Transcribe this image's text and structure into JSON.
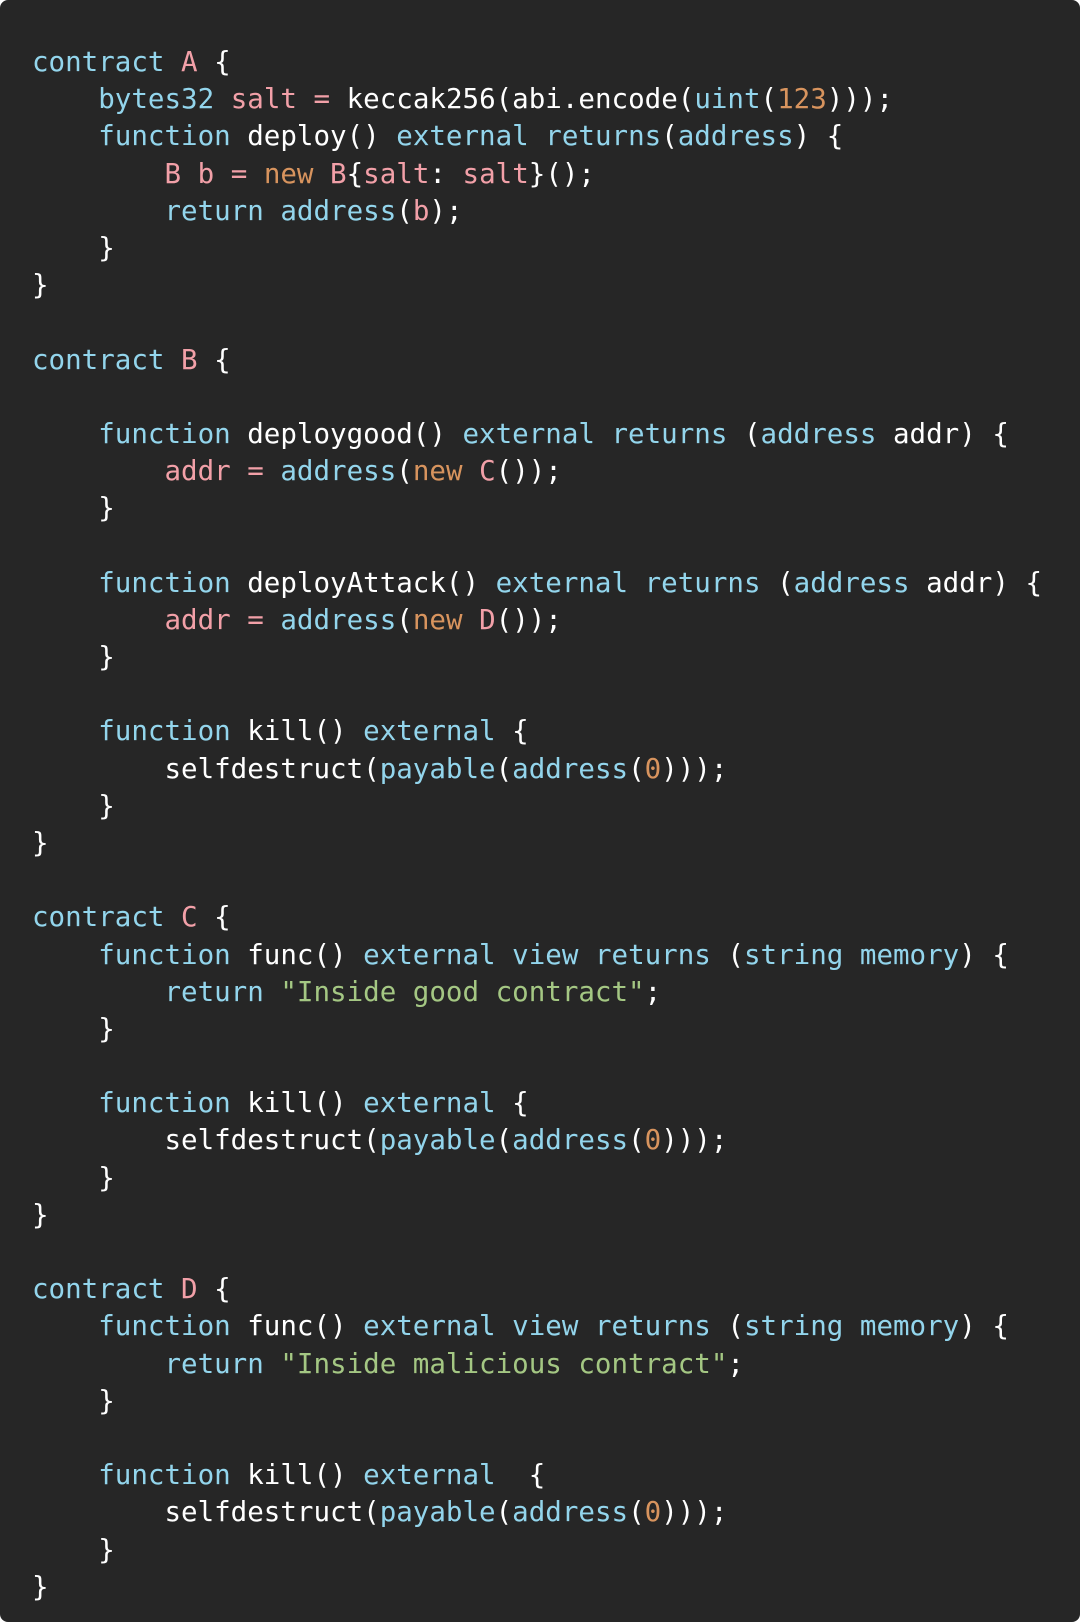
{
  "theme": {
    "background": "#262626",
    "default": "#ffffff",
    "keyword": "#93d5ec",
    "name": "#f2a0a8",
    "number": "#d8945e",
    "string": "#a4c783"
  },
  "code": {
    "language": "solidity",
    "lines": [
      [
        [
          "keyword",
          "contract"
        ],
        [
          "default",
          " "
        ],
        [
          "name",
          "A"
        ],
        [
          "default",
          " {"
        ]
      ],
      [
        [
          "default",
          "    "
        ],
        [
          "keyword",
          "bytes32"
        ],
        [
          "default",
          " "
        ],
        [
          "name",
          "salt"
        ],
        [
          "default",
          " "
        ],
        [
          "name",
          "="
        ],
        [
          "default",
          " keccak256(abi.encode("
        ],
        [
          "keyword",
          "uint"
        ],
        [
          "default",
          "("
        ],
        [
          "number",
          "123"
        ],
        [
          "default",
          ")));"
        ]
      ],
      [
        [
          "default",
          "    "
        ],
        [
          "keyword",
          "function"
        ],
        [
          "default",
          " deploy() "
        ],
        [
          "keyword",
          "external"
        ],
        [
          "default",
          " "
        ],
        [
          "keyword",
          "returns"
        ],
        [
          "default",
          "("
        ],
        [
          "keyword",
          "address"
        ],
        [
          "default",
          ") {"
        ]
      ],
      [
        [
          "default",
          "        "
        ],
        [
          "name",
          "B b"
        ],
        [
          "default",
          " "
        ],
        [
          "name",
          "="
        ],
        [
          "default",
          " "
        ],
        [
          "number",
          "new"
        ],
        [
          "default",
          " "
        ],
        [
          "name",
          "B"
        ],
        [
          "default",
          "{"
        ],
        [
          "name",
          "salt"
        ],
        [
          "default",
          ": "
        ],
        [
          "name",
          "salt"
        ],
        [
          "default",
          "}();"
        ]
      ],
      [
        [
          "default",
          "        "
        ],
        [
          "keyword",
          "return"
        ],
        [
          "default",
          " "
        ],
        [
          "keyword",
          "address"
        ],
        [
          "default",
          "("
        ],
        [
          "name",
          "b"
        ],
        [
          "default",
          ");"
        ]
      ],
      [
        [
          "default",
          "    }"
        ]
      ],
      [
        [
          "default",
          "}"
        ]
      ],
      [],
      [
        [
          "keyword",
          "contract"
        ],
        [
          "default",
          " "
        ],
        [
          "name",
          "B"
        ],
        [
          "default",
          " {"
        ]
      ],
      [],
      [
        [
          "default",
          "    "
        ],
        [
          "keyword",
          "function"
        ],
        [
          "default",
          " deploygood() "
        ],
        [
          "keyword",
          "external"
        ],
        [
          "default",
          " "
        ],
        [
          "keyword",
          "returns"
        ],
        [
          "default",
          " ("
        ],
        [
          "keyword",
          "address"
        ],
        [
          "default",
          " addr) {"
        ]
      ],
      [
        [
          "default",
          "        "
        ],
        [
          "name",
          "addr"
        ],
        [
          "default",
          " "
        ],
        [
          "name",
          "="
        ],
        [
          "default",
          " "
        ],
        [
          "keyword",
          "address"
        ],
        [
          "default",
          "("
        ],
        [
          "number",
          "new"
        ],
        [
          "default",
          " "
        ],
        [
          "name",
          "C"
        ],
        [
          "default",
          "());"
        ]
      ],
      [
        [
          "default",
          "    }"
        ]
      ],
      [],
      [
        [
          "default",
          "    "
        ],
        [
          "keyword",
          "function"
        ],
        [
          "default",
          " deployAttack() "
        ],
        [
          "keyword",
          "external"
        ],
        [
          "default",
          " "
        ],
        [
          "keyword",
          "returns"
        ],
        [
          "default",
          " ("
        ],
        [
          "keyword",
          "address"
        ],
        [
          "default",
          " addr) {"
        ]
      ],
      [
        [
          "default",
          "        "
        ],
        [
          "name",
          "addr"
        ],
        [
          "default",
          " "
        ],
        [
          "name",
          "="
        ],
        [
          "default",
          " "
        ],
        [
          "keyword",
          "address"
        ],
        [
          "default",
          "("
        ],
        [
          "number",
          "new"
        ],
        [
          "default",
          " "
        ],
        [
          "name",
          "D"
        ],
        [
          "default",
          "());"
        ]
      ],
      [
        [
          "default",
          "    }"
        ]
      ],
      [],
      [
        [
          "default",
          "    "
        ],
        [
          "keyword",
          "function"
        ],
        [
          "default",
          " kill() "
        ],
        [
          "keyword",
          "external"
        ],
        [
          "default",
          " {"
        ]
      ],
      [
        [
          "default",
          "        selfdestruct("
        ],
        [
          "keyword",
          "payable"
        ],
        [
          "default",
          "("
        ],
        [
          "keyword",
          "address"
        ],
        [
          "default",
          "("
        ],
        [
          "number",
          "0"
        ],
        [
          "default",
          ")));"
        ]
      ],
      [
        [
          "default",
          "    }"
        ]
      ],
      [
        [
          "default",
          "}"
        ]
      ],
      [],
      [
        [
          "keyword",
          "contract"
        ],
        [
          "default",
          " "
        ],
        [
          "name",
          "C"
        ],
        [
          "default",
          " {"
        ]
      ],
      [
        [
          "default",
          "    "
        ],
        [
          "keyword",
          "function"
        ],
        [
          "default",
          " func() "
        ],
        [
          "keyword",
          "external"
        ],
        [
          "default",
          " "
        ],
        [
          "keyword",
          "view"
        ],
        [
          "default",
          " "
        ],
        [
          "keyword",
          "returns"
        ],
        [
          "default",
          " ("
        ],
        [
          "keyword",
          "string"
        ],
        [
          "default",
          " "
        ],
        [
          "keyword",
          "memory"
        ],
        [
          "default",
          ") {"
        ]
      ],
      [
        [
          "default",
          "        "
        ],
        [
          "keyword",
          "return"
        ],
        [
          "default",
          " "
        ],
        [
          "string",
          "\"Inside good contract\""
        ],
        [
          "default",
          ";"
        ]
      ],
      [
        [
          "default",
          "    }"
        ]
      ],
      [],
      [
        [
          "default",
          "    "
        ],
        [
          "keyword",
          "function"
        ],
        [
          "default",
          " kill() "
        ],
        [
          "keyword",
          "external"
        ],
        [
          "default",
          " {"
        ]
      ],
      [
        [
          "default",
          "        selfdestruct("
        ],
        [
          "keyword",
          "payable"
        ],
        [
          "default",
          "("
        ],
        [
          "keyword",
          "address"
        ],
        [
          "default",
          "("
        ],
        [
          "number",
          "0"
        ],
        [
          "default",
          ")));"
        ]
      ],
      [
        [
          "default",
          "    }"
        ]
      ],
      [
        [
          "default",
          "}"
        ]
      ],
      [],
      [
        [
          "keyword",
          "contract"
        ],
        [
          "default",
          " "
        ],
        [
          "name",
          "D"
        ],
        [
          "default",
          " {"
        ]
      ],
      [
        [
          "default",
          "    "
        ],
        [
          "keyword",
          "function"
        ],
        [
          "default",
          " func() "
        ],
        [
          "keyword",
          "external"
        ],
        [
          "default",
          " "
        ],
        [
          "keyword",
          "view"
        ],
        [
          "default",
          " "
        ],
        [
          "keyword",
          "returns"
        ],
        [
          "default",
          " ("
        ],
        [
          "keyword",
          "string"
        ],
        [
          "default",
          " "
        ],
        [
          "keyword",
          "memory"
        ],
        [
          "default",
          ") {"
        ]
      ],
      [
        [
          "default",
          "        "
        ],
        [
          "keyword",
          "return"
        ],
        [
          "default",
          " "
        ],
        [
          "string",
          "\"Inside malicious contract\""
        ],
        [
          "default",
          ";"
        ]
      ],
      [
        [
          "default",
          "    }"
        ]
      ],
      [],
      [
        [
          "default",
          "    "
        ],
        [
          "keyword",
          "function"
        ],
        [
          "default",
          " kill() "
        ],
        [
          "keyword",
          "external"
        ],
        [
          "default",
          "  {"
        ]
      ],
      [
        [
          "default",
          "        selfdestruct("
        ],
        [
          "keyword",
          "payable"
        ],
        [
          "default",
          "("
        ],
        [
          "keyword",
          "address"
        ],
        [
          "default",
          "("
        ],
        [
          "number",
          "0"
        ],
        [
          "default",
          ")));"
        ]
      ],
      [
        [
          "default",
          "    }"
        ]
      ],
      [
        [
          "default",
          "}"
        ]
      ]
    ]
  }
}
